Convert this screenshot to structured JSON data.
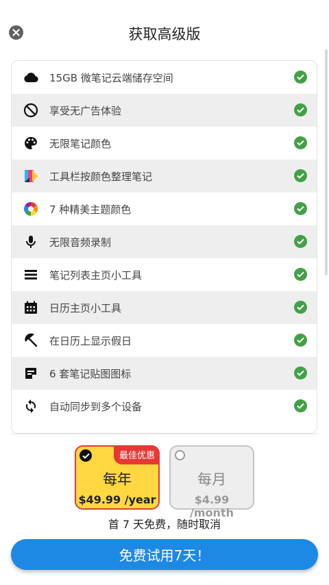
{
  "header": {
    "title": "获取高级版"
  },
  "features": [
    {
      "icon": "cloud-icon",
      "label": "15GB 微笔记云端储存空间"
    },
    {
      "icon": "no-ads-icon",
      "label": "享受无广告体验"
    },
    {
      "icon": "palette-icon",
      "label": "无限笔记颜色"
    },
    {
      "icon": "toolbar-color-icon",
      "label": "工具栏按颜色整理笔记"
    },
    {
      "icon": "color-wheel-icon",
      "label": "7 种精美主题颜色"
    },
    {
      "icon": "microphone-icon",
      "label": "无限音频录制"
    },
    {
      "icon": "list-icon",
      "label": "笔记列表主页小工具"
    },
    {
      "icon": "calendar-icon",
      "label": "日历主页小工具"
    },
    {
      "icon": "beach-umbrella-icon",
      "label": "在日历上显示假日"
    },
    {
      "icon": "sticker-icon",
      "label": "6 套笔记贴图图标"
    },
    {
      "icon": "sync-icon",
      "label": "自动同步到多个设备"
    }
  ],
  "plans": {
    "yearly": {
      "name": "每年",
      "price": "$49.99 /year",
      "badge": "最佳优惠",
      "selected": true
    },
    "monthly": {
      "name": "每月",
      "price": "$4.99 /month",
      "selected": false
    }
  },
  "note": "首 7 天免费，随时取消",
  "cta": {
    "label": "免费试用7天！"
  },
  "colors": {
    "accent": "#1e88e5",
    "check": "#43a047",
    "badge": "#e53935",
    "selected_plan": "#ffd740"
  }
}
